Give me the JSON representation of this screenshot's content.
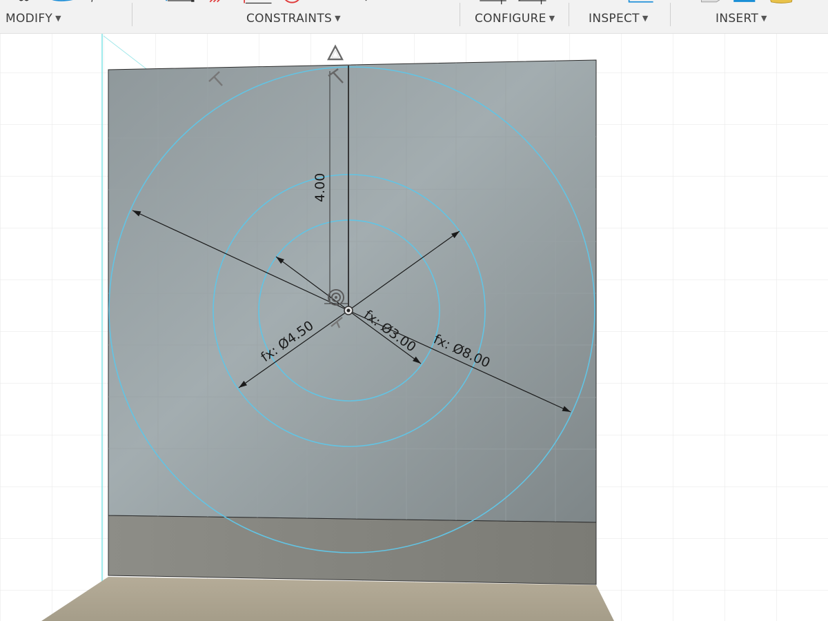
{
  "toolbar": {
    "groups": [
      {
        "label": "MODIFY"
      },
      {
        "label": "CONSTRAINTS"
      },
      {
        "label": "CONFIGURE"
      },
      {
        "label": "INSPECT"
      },
      {
        "label": "INSERT"
      }
    ]
  },
  "sketch": {
    "dimensions": {
      "vertical": "4.00",
      "outer_diameter": "fx: Ø8.00",
      "middle_diameter": "fx: Ø4.50",
      "inner_diameter": "fx: Ø3.00"
    }
  },
  "colors": {
    "sketch_curve": "#62c4e4",
    "face": "#9aa6aa",
    "toolbar_bg": "#f2f2f2",
    "constraint_red": "#e03b3b",
    "accent_blue": "#1e8fd8"
  }
}
